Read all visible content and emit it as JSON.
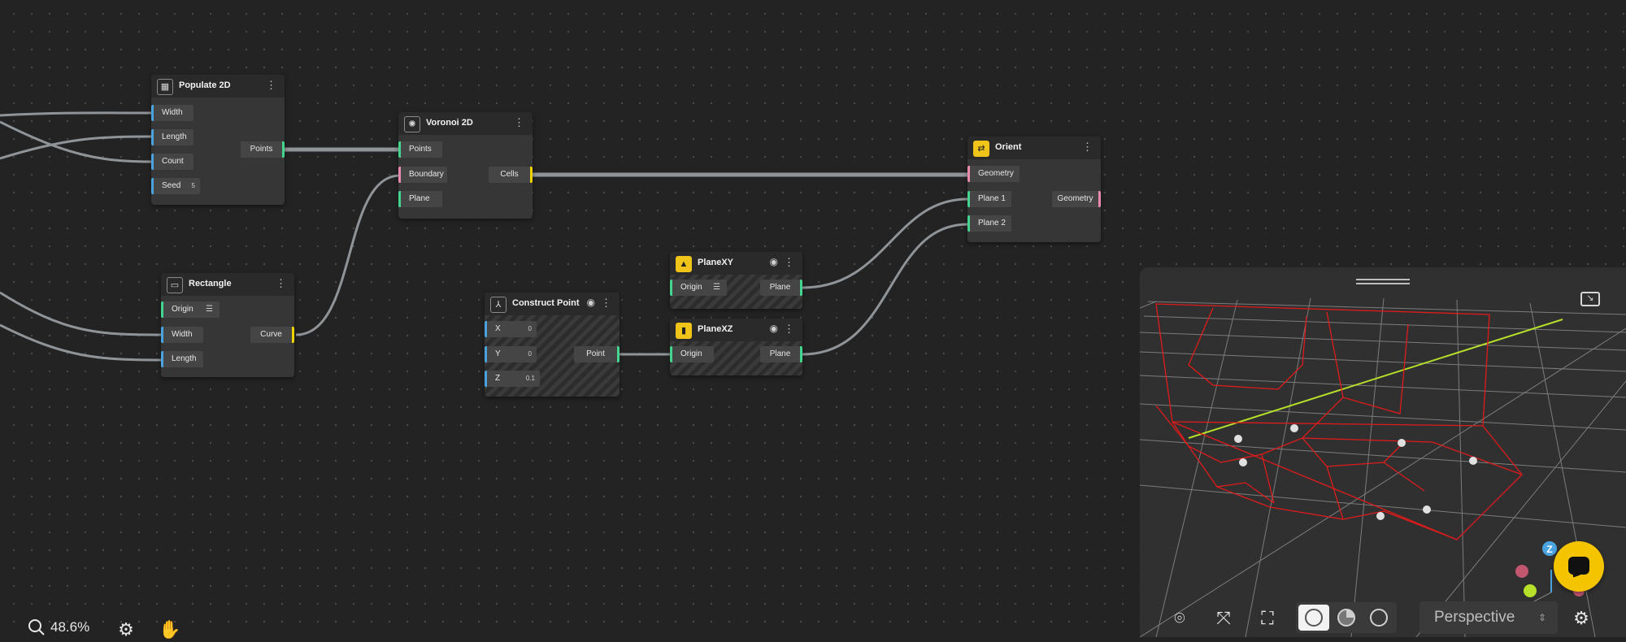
{
  "nodes": {
    "populate2d": {
      "title": "Populate 2D",
      "inputs": {
        "width": "Width",
        "length": "Length",
        "count": "Count",
        "seed": "Seed",
        "seed_value": "5"
      },
      "output": "Points",
      "icon": "grid-square-icon"
    },
    "rectangle": {
      "title": "Rectangle",
      "inputs": {
        "origin": "Origin",
        "width": "Width",
        "length": "Length"
      },
      "output": "Curve",
      "icon": "rectangle-icon"
    },
    "voronoi2d": {
      "title": "Voronoi 2D",
      "inputs": {
        "points": "Points",
        "boundary": "Boundary",
        "plane": "Plane"
      },
      "output": "Cells",
      "icon": "voronoi-icon"
    },
    "construct_point": {
      "title": "Construct Point",
      "inputs": {
        "x": "X",
        "x_value": "0",
        "y": "Y",
        "y_value": "0",
        "z": "Z",
        "z_value": "0.1"
      },
      "output": "Point",
      "icon": "axes-icon"
    },
    "planexy": {
      "title": "PlaneXY",
      "inputs": {
        "origin": "Origin"
      },
      "output": "Plane",
      "icon": "plane-xy-icon"
    },
    "planexz": {
      "title": "PlaneXZ",
      "inputs": {
        "origin": "Origin"
      },
      "output": "Plane",
      "icon": "plane-xz-icon"
    },
    "orient": {
      "title": "Orient",
      "inputs": {
        "geometry": "Geometry",
        "plane1": "Plane 1",
        "plane2": "Plane 2"
      },
      "output": "Geometry",
      "icon": "orient-icon"
    }
  },
  "status": {
    "zoom": "48.6%"
  },
  "viewport": {
    "projection": "Perspective",
    "axis_label": "Z",
    "colors": {
      "geometry": "#e01b1b",
      "grid": "#8a8a8a",
      "x_axis": "#b6e02a",
      "accent": "#f5c400"
    }
  }
}
